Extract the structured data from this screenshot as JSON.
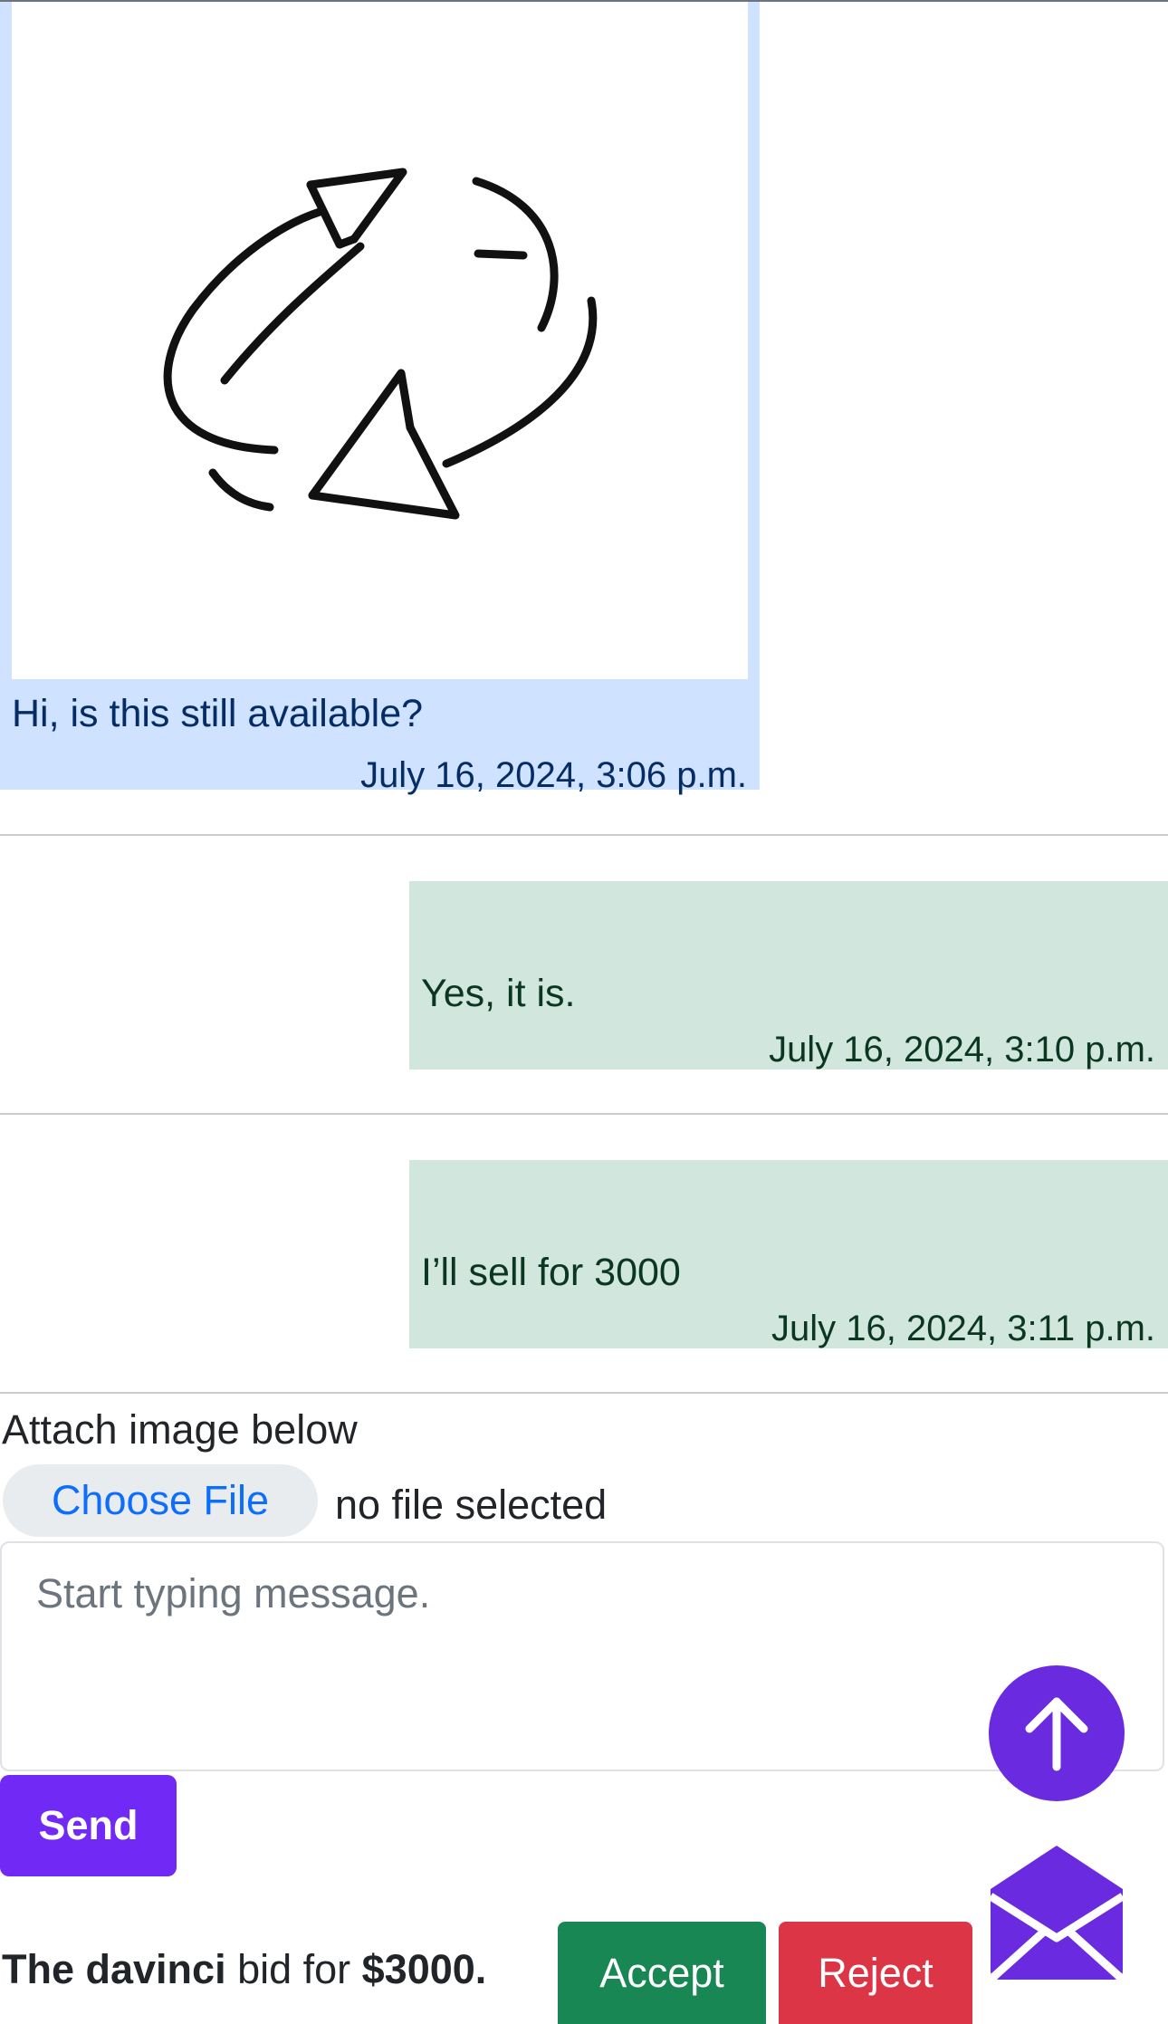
{
  "messages": [
    {
      "side": "left",
      "has_image": true,
      "image_icon": "refresh-arrows-icon",
      "text": "Hi, is this still available?",
      "time": "July 16, 2024, 3:06 p.m."
    },
    {
      "side": "right",
      "has_image": false,
      "text": "Yes, it is.",
      "time": "July 16, 2024, 3:10 p.m."
    },
    {
      "side": "right",
      "has_image": false,
      "text": "I’ll sell for 3000",
      "time": "July 16, 2024, 3:11 p.m."
    }
  ],
  "composer": {
    "attach_label": "Attach image below",
    "choose_file_label": "Choose File",
    "file_status": "no file selected",
    "message_placeholder": "Start typing message.",
    "message_value": "",
    "send_label": "Send"
  },
  "bid": {
    "bidder": "The davinci",
    "middle": " bid for ",
    "amount": "$3000.",
    "accept_label": "Accept",
    "reject_label": "Reject"
  },
  "icons": {
    "scroll_top": "arrow-up-icon",
    "messages": "envelope-open-icon"
  },
  "colors": {
    "sent_bubble": "#cfe2ff",
    "received_bubble": "#d1e7dd",
    "primary_purple": "#7129f5",
    "accept_green": "#198754",
    "reject_red": "#dc3545",
    "link_blue": "#0d6efd"
  }
}
